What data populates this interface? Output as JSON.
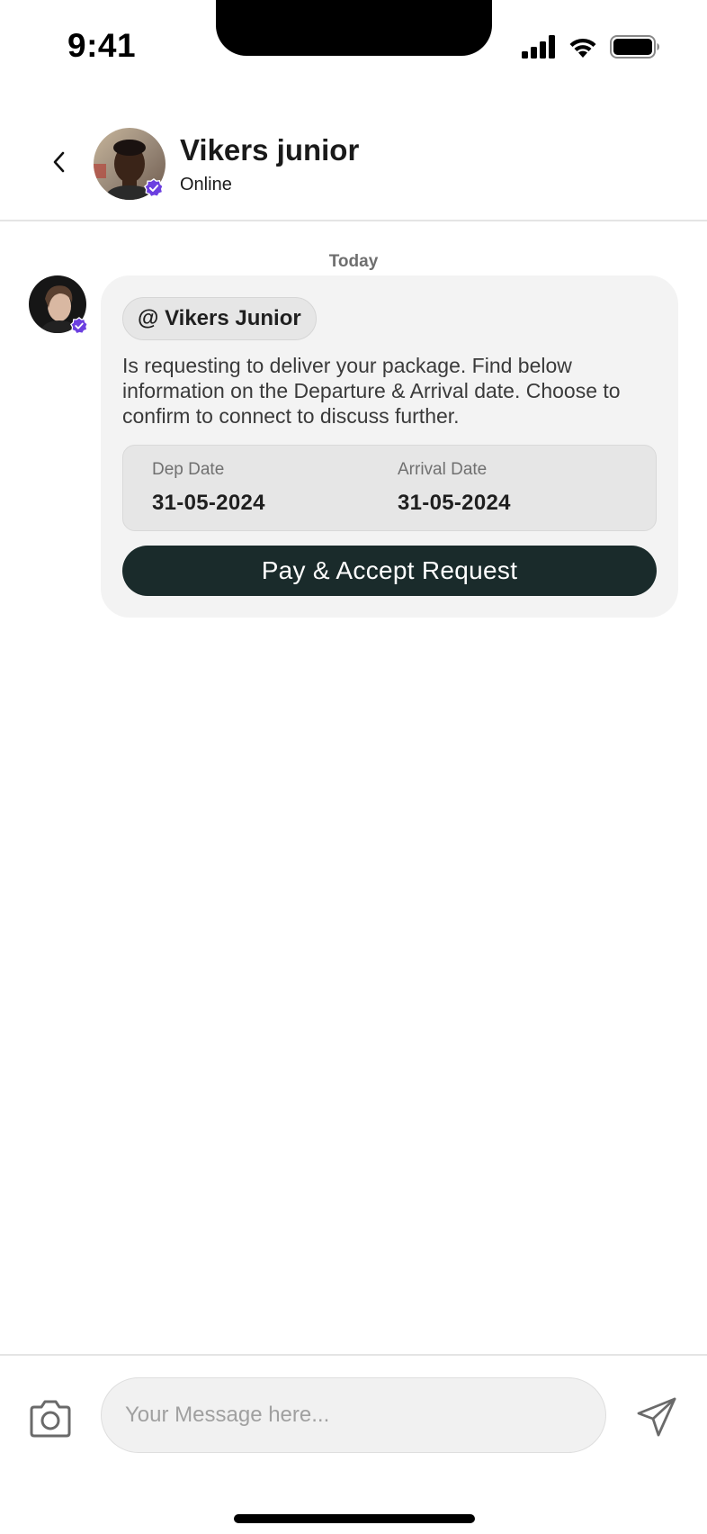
{
  "status_bar": {
    "time": "9:41"
  },
  "header": {
    "name": "Vikers junior",
    "status": "Online"
  },
  "chat": {
    "date_divider": "Today",
    "message": {
      "mention": "@ Vikers Junior",
      "text": "Is requesting to deliver your package. Find below information on the Departure & Arrival date. Choose to confirm to connect to discuss further.",
      "dep_label": "Dep Date",
      "dep_value": "31-05-2024",
      "arr_label": "Arrival Date",
      "arr_value": "31-05-2024",
      "button_label": "Pay & Accept Request"
    }
  },
  "composer": {
    "placeholder": "Your Message here..."
  },
  "colors": {
    "verified_badge": "#6c3fe0",
    "bubble_bg": "#f3f3f3",
    "primary_button": "#1a2b2b"
  },
  "icons": [
    "signal-icon",
    "wifi-icon",
    "battery-icon",
    "back-chevron-icon",
    "verified-badge-icon",
    "camera-icon",
    "send-icon"
  ]
}
